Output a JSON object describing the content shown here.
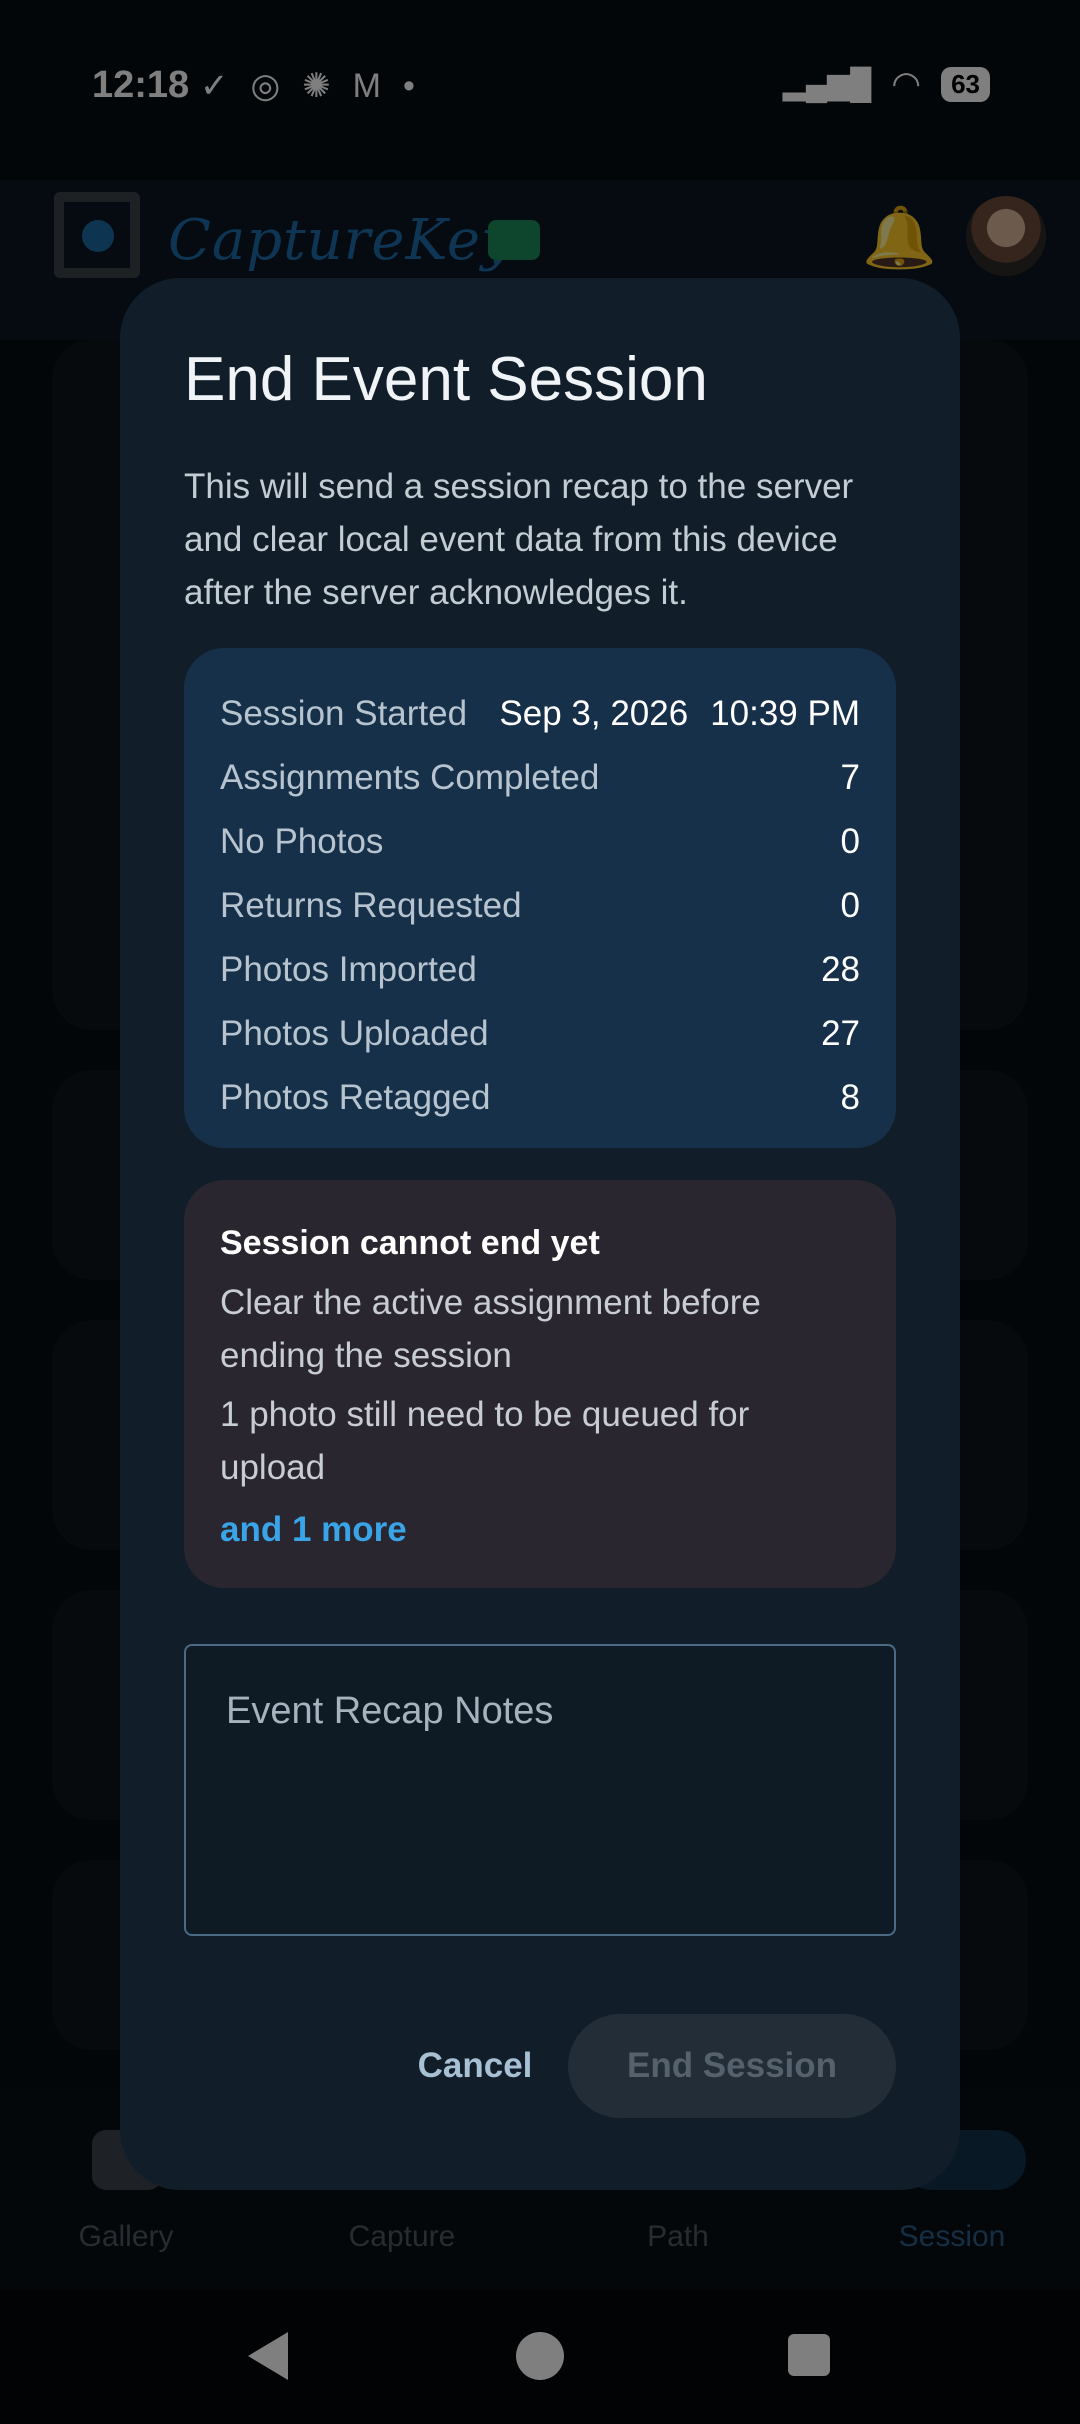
{
  "status_bar": {
    "time": "12:18",
    "battery": "63"
  },
  "app": {
    "brand": "CaptureKey"
  },
  "bottom_nav": [
    {
      "label": "Gallery"
    },
    {
      "label": "Capture"
    },
    {
      "label": "Path"
    },
    {
      "label": "Session"
    }
  ],
  "dialog": {
    "title": "End Event Session",
    "body": "This will send a session recap to the server and clear local event data from this device after the server acknowledges it.",
    "summary": {
      "session_started_label": "Session Started",
      "session_started_date": "Sep 3, 2026",
      "session_started_time": "10:39 PM",
      "rows": [
        {
          "label": "Assignments Completed",
          "value": "7"
        },
        {
          "label": "No Photos",
          "value": "0"
        },
        {
          "label": "Returns Requested",
          "value": "0"
        },
        {
          "label": "Photos Imported",
          "value": "28"
        },
        {
          "label": "Photos Uploaded",
          "value": "27"
        },
        {
          "label": "Photos Retagged",
          "value": "8"
        }
      ]
    },
    "warning": {
      "title": "Session cannot end yet",
      "items": [
        "Clear the active assignment before ending the session",
        "1 photo still need to be queued for upload"
      ],
      "more_link": "and 1 more"
    },
    "notes": {
      "placeholder": "Event Recap Notes",
      "value": ""
    },
    "cancel_label": "Cancel",
    "end_label": "End Session"
  }
}
